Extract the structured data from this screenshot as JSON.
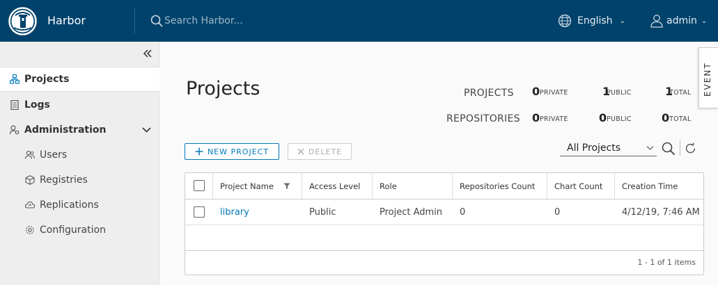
{
  "header": {
    "brand": "Harbor",
    "search_placeholder": "Search Harbor...",
    "language": "English",
    "user": "admin"
  },
  "sidebar": {
    "items": [
      {
        "label": "Projects",
        "icon": "projects-icon",
        "active": true
      },
      {
        "label": "Logs",
        "icon": "logs-icon"
      },
      {
        "label": "Administration",
        "icon": "administration-icon",
        "expanded": true
      }
    ],
    "sub_items": [
      {
        "label": "Users",
        "icon": "users-icon"
      },
      {
        "label": "Registries",
        "icon": "registries-icon"
      },
      {
        "label": "Replications",
        "icon": "replications-icon"
      },
      {
        "label": "Configuration",
        "icon": "configuration-icon"
      }
    ]
  },
  "main": {
    "title": "Projects",
    "stats": {
      "projects_label": "PROJECTS",
      "repositories_label": "REPOSITORIES",
      "projects": {
        "private": "0",
        "public": "1",
        "total": "1"
      },
      "repositories": {
        "private": "0",
        "public": "0",
        "total": "0"
      },
      "private_label": "PRIVATE",
      "public_label": "PUBLIC",
      "total_label": "TOTAL"
    },
    "event_tab": "EVENT",
    "new_project_label": "NEW PROJECT",
    "delete_label": "DELETE",
    "filter_value": "All Projects",
    "table": {
      "columns": [
        "Project Name",
        "Access Level",
        "Role",
        "Repositories Count",
        "Chart Count",
        "Creation Time"
      ],
      "rows": [
        {
          "name": "library",
          "access": "Public",
          "role": "Project Admin",
          "repos": "0",
          "charts": "0",
          "created": "4/12/19, 7:46 AM"
        }
      ],
      "footer": "1 - 1 of 1 items"
    }
  },
  "colors": {
    "header_bg": "#00426b",
    "accent": "#0079b8"
  }
}
